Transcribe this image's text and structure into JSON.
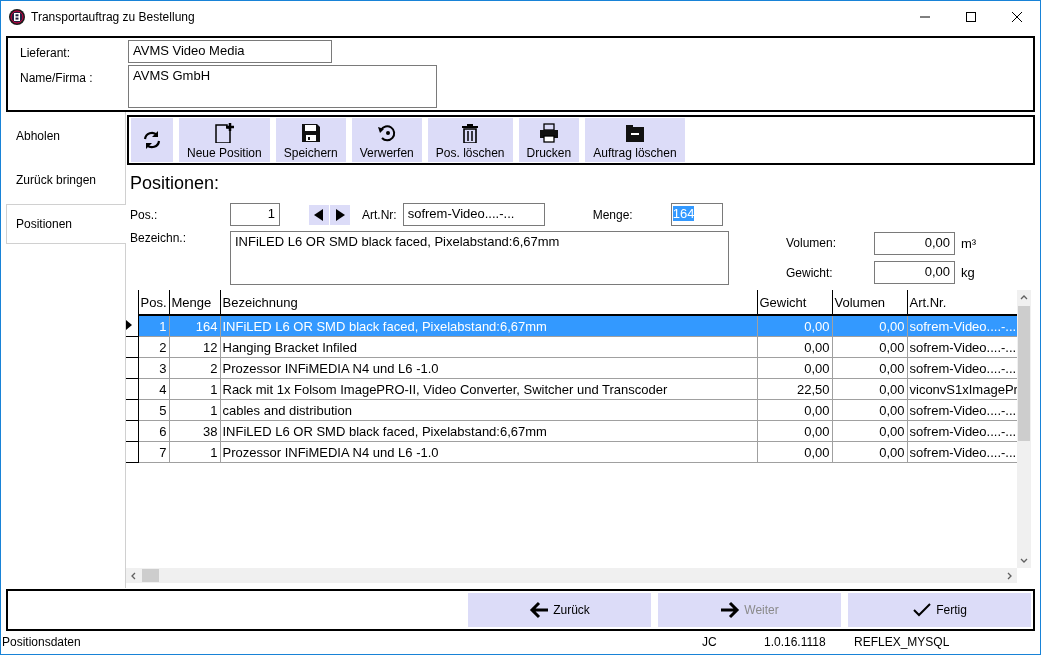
{
  "window": {
    "title": "Transportauftrag zu Bestellung"
  },
  "header": {
    "fields": [
      {
        "label": "Lieferant:",
        "value": "AVMS Video Media",
        "kind": "single"
      },
      {
        "label": "Name/Firma :",
        "value": "AVMS GmbH",
        "kind": "multi"
      }
    ]
  },
  "tabs": [
    {
      "label": "Abholen",
      "selected": false
    },
    {
      "label": "Zurück bringen",
      "selected": false
    },
    {
      "label": "Positionen",
      "selected": true
    }
  ],
  "toolbar": [
    {
      "kind": "refresh"
    },
    {
      "kind": "new",
      "label": "Neue Position"
    },
    {
      "kind": "save",
      "label": "Speichern"
    },
    {
      "kind": "discard",
      "label": "Verwerfen"
    },
    {
      "kind": "delete",
      "label": "Pos. löschen"
    },
    {
      "kind": "print",
      "label": "Drucken"
    },
    {
      "kind": "folder",
      "label": "Auftrag löschen"
    }
  ],
  "positions": {
    "heading": "Positionen:",
    "pos": {
      "label": "Pos.:",
      "value": "1"
    },
    "artnr": {
      "label": "Art.Nr:",
      "value": "sofrem-Video....-..."
    },
    "menge": {
      "label": "Menge:",
      "value": "164",
      "text_selected": true
    },
    "bezeichnung": {
      "label": "Bezeichn.:",
      "value": "INFiLED L6 OR SMD black faced, Pixelabstand:6,67mm"
    },
    "volumen": {
      "label": "Volumen:",
      "value": "0,00",
      "unit": "m³"
    },
    "gewicht": {
      "label": "Gewicht:",
      "value": "0,00",
      "unit": "kg"
    }
  },
  "table": {
    "columns": [
      "Pos.",
      "Menge",
      "Bezeichnung",
      "Gewicht",
      "Volumen",
      "Art.Nr."
    ],
    "rows": [
      {
        "selected": true,
        "cells": [
          "1",
          "164",
          "INFiLED L6 OR SMD black faced, Pixelabstand:6,67mm",
          "0,00",
          "0,00",
          "sofrem-Video....-..."
        ]
      },
      {
        "selected": false,
        "cells": [
          "2",
          "12",
          "Hanging Bracket Infiled",
          "0,00",
          "0,00",
          "sofrem-Video....-..."
        ]
      },
      {
        "selected": false,
        "cells": [
          "3",
          "2",
          "Prozessor INFiMEDIA N4 und L6 -1.0",
          "0,00",
          "0,00",
          "sofrem-Video....-..."
        ]
      },
      {
        "selected": false,
        "cells": [
          "4",
          "1",
          "Rack mit 1x Folsom ImagePRO-II, Video Converter, Switcher und Transcoder",
          "22,50",
          "0,00",
          "viconvS1xImagePr"
        ]
      },
      {
        "selected": false,
        "cells": [
          "5",
          "1",
          "cables and distribution",
          "0,00",
          "0,00",
          "sofrem-Video....-..."
        ]
      },
      {
        "selected": false,
        "cells": [
          "6",
          "38",
          "INFiLED L6 OR SMD black faced, Pixelabstand:6,67mm",
          "0,00",
          "0,00",
          "sofrem-Video....-..."
        ]
      },
      {
        "selected": false,
        "cells": [
          "7",
          "1",
          "Prozessor INFiMEDIA N4 und L6 -1.0",
          "0,00",
          "0,00",
          "sofrem-Video....-..."
        ]
      }
    ]
  },
  "footer_buttons": [
    {
      "kind": "back",
      "label": "Zurück",
      "disabled": false
    },
    {
      "kind": "next",
      "label": "Weiter",
      "disabled": true
    },
    {
      "kind": "done",
      "label": "Fertig",
      "disabled": false
    }
  ],
  "status_bar": [
    "Positionsdaten",
    "JC",
    "1.0.16.1118",
    "REFLEX_MYSQL"
  ]
}
